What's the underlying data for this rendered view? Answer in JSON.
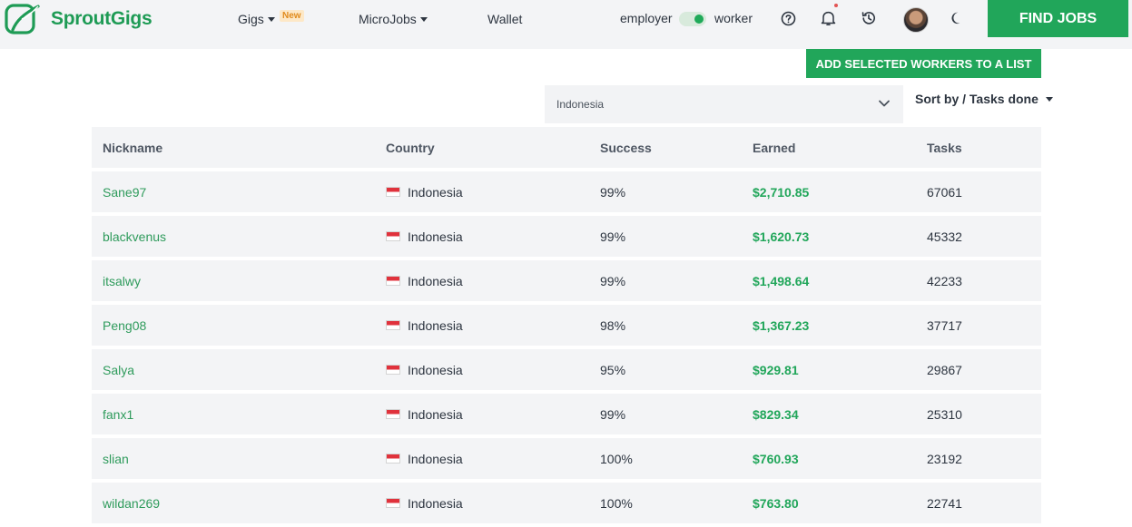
{
  "header": {
    "brand": "SproutGigs",
    "nav": {
      "gigs_label": "Gigs",
      "gigs_badge": "New",
      "microjobs_label": "MicroJobs",
      "wallet_label": "Wallet"
    },
    "mode_toggle": {
      "left_label": "employer",
      "right_label": "worker",
      "active": "worker"
    },
    "find_jobs_label": "FIND JOBS",
    "icons": [
      "help-icon",
      "bell-icon",
      "history-icon",
      "avatar",
      "moon-icon"
    ],
    "brand_color": "#21a65a"
  },
  "actions": {
    "add_selected_label": "ADD SELECTED WORKERS TO A LIST",
    "country_filter_value": "Indonesia",
    "sort_label": "Sort by / Tasks done"
  },
  "table": {
    "columns": [
      "Nickname",
      "Country",
      "Success",
      "Earned",
      "Tasks"
    ],
    "rows": [
      {
        "nickname": "Sane97",
        "country": "Indonesia",
        "success": "99%",
        "earned": "$2,710.85",
        "tasks": "67061"
      },
      {
        "nickname": "blackvenus",
        "country": "Indonesia",
        "success": "99%",
        "earned": "$1,620.73",
        "tasks": "45332"
      },
      {
        "nickname": "itsalwy",
        "country": "Indonesia",
        "success": "99%",
        "earned": "$1,498.64",
        "tasks": "42233"
      },
      {
        "nickname": "Peng08",
        "country": "Indonesia",
        "success": "98%",
        "earned": "$1,367.23",
        "tasks": "37717"
      },
      {
        "nickname": "Salya",
        "country": "Indonesia",
        "success": "95%",
        "earned": "$929.81",
        "tasks": "29867"
      },
      {
        "nickname": "fanx1",
        "country": "Indonesia",
        "success": "99%",
        "earned": "$829.34",
        "tasks": "25310"
      },
      {
        "nickname": "slian",
        "country": "Indonesia",
        "success": "100%",
        "earned": "$760.93",
        "tasks": "23192"
      },
      {
        "nickname": "wildan269",
        "country": "Indonesia",
        "success": "100%",
        "earned": "$763.80",
        "tasks": "22741"
      }
    ]
  }
}
